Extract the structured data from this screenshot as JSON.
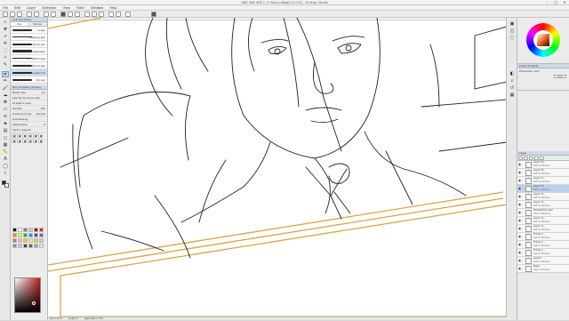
{
  "window": {
    "title": "ZNZ 048-49Ã 1-72 Keys (d6dg/t Gr 2%) - Gnlingr Studio",
    "minimize": "–",
    "maximize": "□",
    "close": "✕"
  },
  "menu": [
    "File",
    "Edit",
    "Layer",
    "Selection",
    "View",
    "Filter",
    "Window",
    "Help"
  ],
  "subtool": {
    "header": "Sub tool [Pen]",
    "tabs": [
      "Pen",
      "Marker"
    ],
    "brushes": [
      {
        "label": "G-pen"
      },
      {
        "label": "Mapping pen"
      },
      {
        "label": "Turnip pen"
      },
      {
        "label": "Calligraphy"
      },
      {
        "label": "For effect lines"
      },
      {
        "label": "Textured pen"
      },
      {
        "label": "Streaked ink"
      },
      {
        "label": "Ink pen"
      }
    ],
    "detail_header": "Tool property [G-pen]",
    "props": [
      {
        "label": "Brush Size",
        "value": "4.0"
      },
      {
        "label": "Specify by screen size",
        "value": ""
      },
      {
        "label": "At least 1 pixel",
        "value": ""
      },
      {
        "label": "Opacity",
        "value": "100"
      },
      {
        "label": "Combine mode",
        "value": "Normal"
      },
      {
        "label": "Anti-aliasing",
        "value": ""
      },
      {
        "label": "Stabilization",
        "value": "8"
      },
      {
        "label": "Vector magnet",
        "value": ""
      }
    ]
  },
  "colors": {
    "accent": "#6b8fbf",
    "selection": "#bcd2ec",
    "frame_line": "#d9a640",
    "main_color": "#e35a1b"
  },
  "palette": [
    "#000000",
    "#ffffff",
    "#7f7f7f",
    "#c3c3c3",
    "#880015",
    "#ed1c24",
    "#ff7f27",
    "#fff200",
    "#22b14c",
    "#00a2e8",
    "#3f48cc",
    "#a349a4",
    "#b97a57",
    "#ffaec9",
    "#ffc90e",
    "#efe4b0",
    "#b5e61d",
    "#99d9ea",
    "#7092be",
    "#c8bfe7",
    "#404040",
    "#606060",
    "#a0a0a0",
    "#e0e0e0"
  ],
  "layer_property": {
    "header": "Layer Property",
    "expression_label": "Expression color",
    "expression_value": "Color"
  },
  "layers": {
    "header": "Layer",
    "items": [
      {
        "name": "Layer 19",
        "mode": "100 % Normal",
        "selected": false
      },
      {
        "name": "Layer 18",
        "mode": "100 % Normal",
        "selected": false
      },
      {
        "name": "Layer 17",
        "mode": "100 % Normal",
        "selected": false
      },
      {
        "name": "Layer 16",
        "mode": "100 % Normal",
        "selected": true
      },
      {
        "name": "Layer 15",
        "mode": "100 % Normal",
        "selected": false
      },
      {
        "name": "Layer 14",
        "mode": "100 % Normal",
        "selected": false
      },
      {
        "name": "Perspective ruler",
        "mode": "100 % Normal",
        "selected": false
      },
      {
        "name": "Layer 12",
        "mode": "100 % Normal",
        "selected": false
      },
      {
        "name": "Layer 11",
        "mode": "100 % Normal",
        "selected": false
      },
      {
        "name": "Frame 3",
        "mode": "100 % Normal",
        "selected": false
      },
      {
        "name": "Frame 2",
        "mode": "100 % Normal",
        "selected": false
      },
      {
        "name": "Frame 1",
        "mode": "100 % Normal",
        "selected": false
      },
      {
        "name": "Layer 1",
        "mode": "100 % Normal",
        "selected": false
      },
      {
        "name": "Paper",
        "mode": "100 % Normal",
        "selected": false
      }
    ]
  },
  "status": {
    "zoom": "Zoom 27%",
    "angle": "Angle 0°",
    "coords": "Application 75%"
  }
}
